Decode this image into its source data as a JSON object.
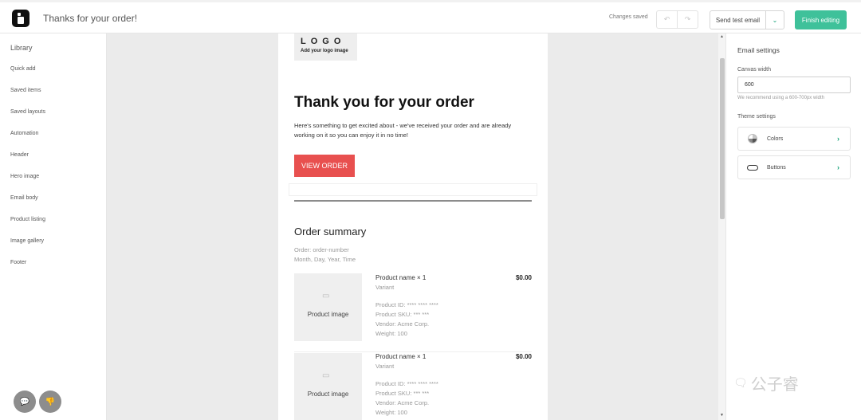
{
  "topbar": {
    "title": "Thanks for your order!",
    "status": "Changes saved",
    "undo_icon": "↶",
    "redo_icon": "↷",
    "send_test_label": "Send test email",
    "send_test_caret": "⌄",
    "finish_label": "Finish editing",
    "accent_color": "#3fc19a"
  },
  "library": {
    "title": "Library",
    "items": [
      {
        "label": "Quick add"
      },
      {
        "label": "Saved items"
      },
      {
        "label": "Saved layouts"
      },
      {
        "label": "Automation"
      },
      {
        "label": "Header"
      },
      {
        "label": "Hero image"
      },
      {
        "label": "Email body"
      },
      {
        "label": "Product listing"
      },
      {
        "label": "Image gallery"
      },
      {
        "label": "Footer"
      }
    ],
    "chat_icon": "💬",
    "feedback_icon": "👎"
  },
  "email": {
    "logo_text": "LOGO",
    "logo_sub": "Add your logo image",
    "title": "Thank you for your order",
    "body": "Here's something to get excited about - we've received your order and are already working on it so you can enjoy it in no time!",
    "button_label": "VIEW ORDER",
    "button_color": "#e8504f",
    "summary_title": "Order summary",
    "order_number": "Order: order-number",
    "order_date": "Month, Day, Year, Time",
    "products": [
      {
        "image_label": "Product image",
        "name": "Product name  × 1",
        "price": "$0.00",
        "variant": "Variant",
        "id": "Product ID: **** **** ****",
        "sku": "Product SKU: *** ***",
        "vendor": "Vendor: Acme Corp.",
        "weight": "Weight: 100"
      },
      {
        "image_label": "Product image",
        "name": "Product name  × 1",
        "price": "$0.00",
        "variant": "Variant",
        "id": "Product ID: **** **** ****",
        "sku": "Product SKU: *** ***",
        "vendor": "Vendor: Acme Corp.",
        "weight": "Weight: 100"
      }
    ]
  },
  "settings": {
    "title": "Email settings",
    "canvas_width_label": "Canvas width",
    "canvas_width_value": "600",
    "canvas_width_hint": "We recommend using a 600-700px width",
    "theme_label": "Theme settings",
    "colors_label": "Colors",
    "buttons_label": "Buttons",
    "chevron": "›"
  },
  "watermark": {
    "text": "公子睿",
    "icon": "🗨"
  }
}
